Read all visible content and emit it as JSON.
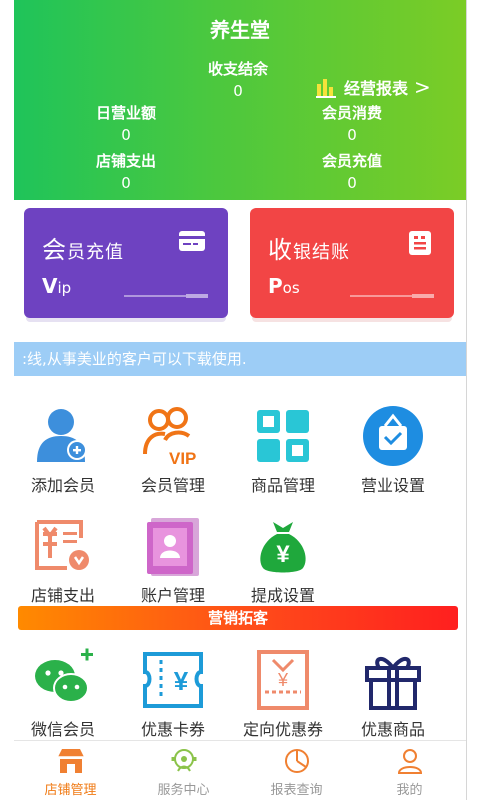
{
  "header": {
    "title": "养生堂",
    "balance_label": "收支结余",
    "balance_value": "0",
    "report_label": "经营报表",
    "report_arrow": ">",
    "daily_revenue_label": "日营业额",
    "daily_revenue_value": "0",
    "member_spend_label": "会员消费",
    "member_spend_value": "0",
    "store_expense_label": "店铺支出",
    "store_expense_value": "0",
    "member_recharge_label": "会员充值",
    "member_recharge_value": "0"
  },
  "cards": {
    "vip": {
      "title_first": "会",
      "title_rest": "员充值",
      "sub_first": "V",
      "sub_rest": "ip"
    },
    "pos": {
      "title_first": "收",
      "title_rest": "银结账",
      "sub_first": "P",
      "sub_rest": "os"
    }
  },
  "marquee": ":线,从事美业的客户可以下载使用.",
  "grid": {
    "add_member": "添加会员",
    "member_mgmt": "会员管理",
    "goods_mgmt": "商品管理",
    "business_settings": "营业设置",
    "store_expense": "店铺支出",
    "account_mgmt": "账户管理",
    "commission_settings": "提成设置"
  },
  "banner": "营销拓客",
  "marketing": {
    "wechat_member": "微信会员",
    "coupon": "优惠卡券",
    "targeted_coupon": "定向优惠券",
    "discount_goods": "优惠商品"
  },
  "icon_text": {
    "vip": "VIP",
    "yen": "¥"
  },
  "nav": {
    "store": "店铺管理",
    "service": "服务中心",
    "report": "报表查询",
    "mine": "我的"
  },
  "colors": {
    "header_start": "#1fc45a",
    "header_end": "#7bcc26",
    "vip_card": "#6e42c1",
    "pos_card": "#f24545",
    "marquee_bg": "#9dcdf6",
    "active_tab": "#f07b16"
  }
}
